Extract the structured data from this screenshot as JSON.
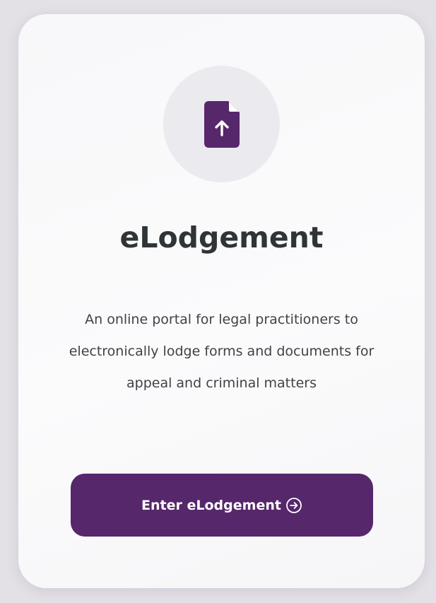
{
  "card": {
    "icon": "file-upload-icon",
    "title": "eLodgement",
    "description": "An online portal for legal practitioners to electronically lodge forms and documents for appeal and criminal matters",
    "cta": {
      "label": "Enter eLodgement",
      "icon": "arrow-right-circle-icon"
    }
  },
  "colors": {
    "accent": "#56276b",
    "icon_circle_bg": "#ebeaef",
    "title_text": "#2f3436",
    "body_text": "#3e4346",
    "page_bg": "#e3e0e6"
  }
}
